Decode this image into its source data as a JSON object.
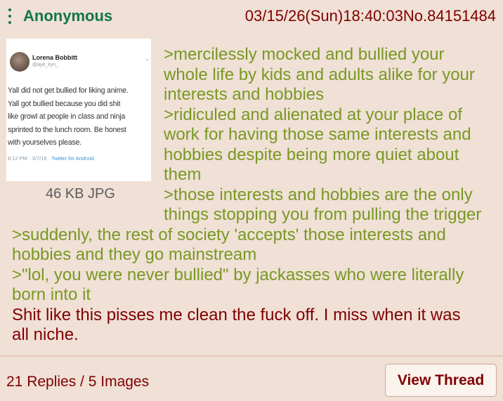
{
  "post": {
    "name": "Anonymous",
    "datetime": "03/15/26(Sun)18:40:03",
    "number": "No.84151484",
    "file_info": "46 KB JPG",
    "thumbnail": {
      "display_name": "Lorena Bobbitt",
      "handle": "@aye_kyn_",
      "tweet_lines": [
        "Yall did not get bullied for liking anime.",
        "Yall got bullied because you did shit",
        "like growl at people in class and ninja",
        "sprinted to the lunch room. Be honest",
        "with yourselves please."
      ],
      "timestamp": "8:12 PM · 3/7/19 · ",
      "via": "Twitter for Android"
    },
    "lines": [
      ">mercilessly mocked and bullied your",
      "whole life by kids and adults alike for your",
      "interests and hobbies",
      ">ridiculed and alienated at your place of",
      "work for having those same interests and",
      "hobbies despite being more quiet about",
      "them",
      ">those interests and hobbies are the only",
      "things stopping you from pulling the trigger",
      ">suddenly, the rest of society 'accepts' those interests and",
      "hobbies and they go mainstream",
      ">\"lol, you were never bullied\" by jackasses who were literally",
      "born into it",
      "Shit like this pisses me clean the fuck off. I miss when it was",
      "all niche."
    ]
  },
  "footer": {
    "summary": "21 Replies / 5 Images",
    "view_thread_label": "View Thread"
  },
  "colors": {
    "background": "#f0e0d6",
    "name": "#117743",
    "greentext": "#789922",
    "text": "#800000"
  }
}
